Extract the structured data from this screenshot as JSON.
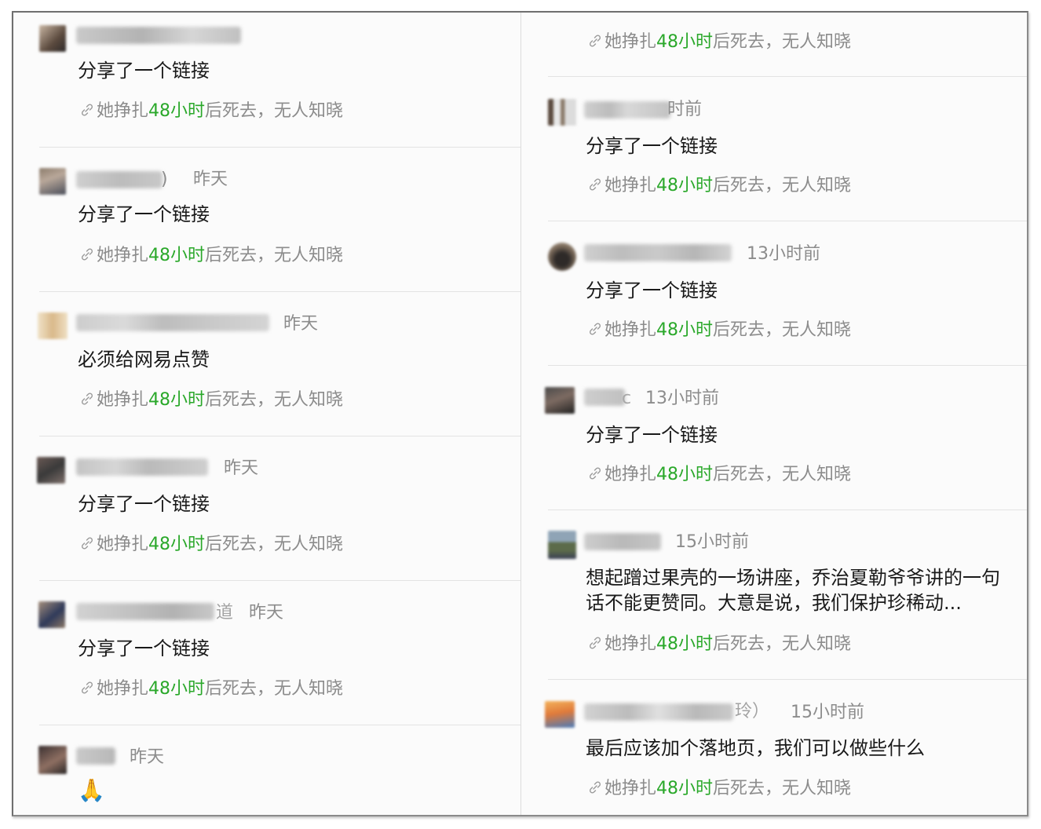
{
  "colors": {
    "accent_green": "#2aa82a",
    "muted_text": "#8c8c8c",
    "body_text": "#1a1a1a",
    "divider": "#e3e3e3"
  },
  "link_card": {
    "icon": "link-icon",
    "prefix": "她挣扎",
    "highlight": "48小时",
    "suffix": "后死去，无人知晓"
  },
  "left_column": [
    {
      "name_visible": "",
      "time": "昨天",
      "content": "分享了一个链接"
    },
    {
      "name_visible": ")",
      "time": "昨天",
      "content": "分享了一个链接"
    },
    {
      "name_visible": "",
      "time": "昨天",
      "content": "必须给网易点赞"
    },
    {
      "name_visible": "",
      "time": "昨天",
      "content": "分享了一个链接"
    },
    {
      "name_visible": "道",
      "time": "昨天",
      "content": "分享了一个链接"
    },
    {
      "name_visible": "",
      "time": "昨天",
      "content": "🙏"
    }
  ],
  "right_column": [
    {
      "name_visible": "",
      "time": "",
      "content": ""
    },
    {
      "name_visible": "",
      "time": "时前",
      "content": "分享了一个链接"
    },
    {
      "name_visible": "",
      "time": "13小时前",
      "content": "分享了一个链接"
    },
    {
      "name_visible": "c",
      "time": "13小时前",
      "content": "分享了一个链接"
    },
    {
      "name_visible": "",
      "time": "15小时前",
      "content": "想起蹭过果壳的一场讲座，乔治夏勒爷爷讲的一句话不能更赞同。大意是说，我们保护珍稀动..."
    },
    {
      "name_visible": "玲）",
      "time": "15小时前",
      "content": "最后应该加个落地页，我们可以做些什么"
    }
  ]
}
